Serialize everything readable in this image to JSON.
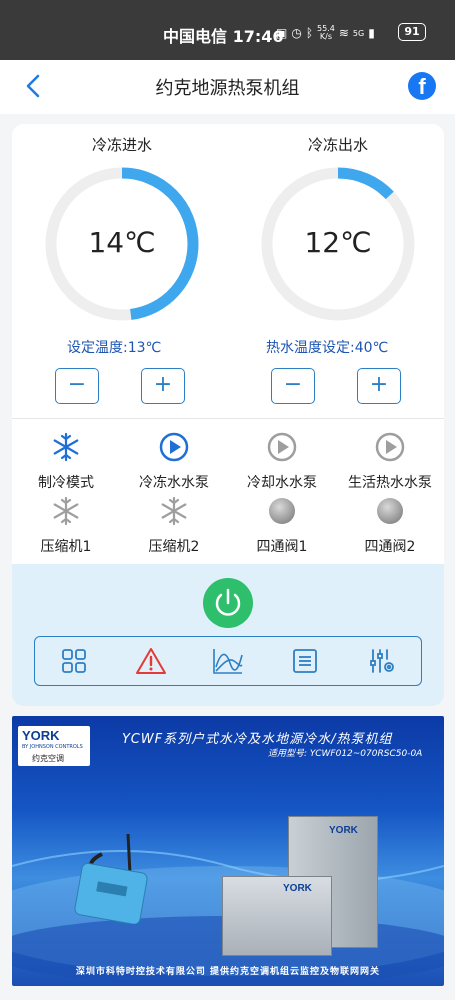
{
  "status_bar": {
    "carrier_time": "中国电信 17:46",
    "net_speed_top": "55.4",
    "net_speed_unit": "K/s",
    "signal_label": "5G",
    "battery": "91"
  },
  "nav": {
    "title": "约克地源热泵机组"
  },
  "gauges": [
    {
      "title": "冷冻进水",
      "value": "14℃",
      "level": 0.48,
      "color": "#3ea7ee"
    },
    {
      "title": "冷冻出水",
      "value": "12℃",
      "level": 0.13,
      "color": "#3ea7ee"
    }
  ],
  "setpoints": {
    "left": "设定温度:13℃",
    "right": "热水温度设定:40℃",
    "minus": "−",
    "plus": "+"
  },
  "status_items": [
    {
      "label": "制冷模式",
      "icon": "snowflake-icon",
      "active": true
    },
    {
      "label": "冷冻水水泵",
      "icon": "pump-play-icon",
      "active": true
    },
    {
      "label": "冷却水水泵",
      "icon": "pump-play-icon",
      "active": false
    },
    {
      "label": "生活热水水泵",
      "icon": "pump-play-icon",
      "active": false
    },
    {
      "label": "压缩机1",
      "icon": "snowflake-icon",
      "active": false
    },
    {
      "label": "压缩机2",
      "icon": "snowflake-icon",
      "active": false
    },
    {
      "label": "四通阀1",
      "icon": "valve-dot-icon",
      "active": false
    },
    {
      "label": "四通阀2",
      "icon": "valve-dot-icon",
      "active": false
    }
  ],
  "toolbar": {
    "items": [
      "grid-icon",
      "alarm-icon",
      "chart-icon",
      "list-icon",
      "settings-sliders-icon"
    ]
  },
  "banner": {
    "logo_brand": "YORK",
    "logo_sub": "BY JOHNSON CONTROLS",
    "logo_cn": "约克空调",
    "title": "YCWF系列户式水冷及水地源冷水/热泵机组",
    "model": "适用型号: YCWF012~070RSC50-0A",
    "footer": "深圳市科特时控技术有限公司  提供约克空调机组云监控及物联网网关",
    "unit_brand": "YORK"
  },
  "colors": {
    "accent": "#2d7fc4",
    "active_icon": "#1f6fd6",
    "inactive_icon": "#9e9e9e",
    "power": "#2dbf6b",
    "alarm": "#e53935"
  }
}
